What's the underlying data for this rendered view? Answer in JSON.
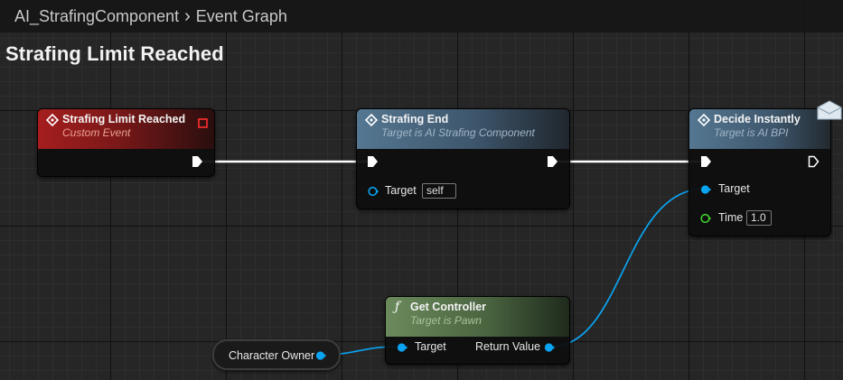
{
  "breadcrumb": {
    "blueprint": "AI_StrafingComponent",
    "graph": "Event Graph"
  },
  "graph_title": "Strafing Limit Reached",
  "nodes": {
    "event": {
      "title": "Strafing Limit Reached",
      "subtitle": "Custom Event",
      "header_color": "#a01c1c"
    },
    "strafing_end": {
      "title": "Strafing End",
      "subtitle": "Target is AI Strafing Component",
      "target_label": "Target",
      "target_value": "self",
      "header_color": "#4f6e8a"
    },
    "decide": {
      "title": "Decide Instantly",
      "subtitle": "Target is AI BPI",
      "target_label": "Target",
      "time_label": "Time",
      "time_value": "1.0",
      "header_color": "#4f6e8a"
    },
    "get_controller": {
      "title": "Get Controller",
      "subtitle": "Target is Pawn",
      "target_label": "Target",
      "return_label": "Return Value",
      "header_color": "#5c7a4f"
    },
    "character_owner": {
      "label": "Character Owner"
    }
  },
  "colors": {
    "object_pin": "#0aa4f0",
    "float_pin": "#3fd02e",
    "exec_wire": "#ffffff"
  },
  "icons": {
    "event": "event-diamond-icon",
    "function": "function-f-icon",
    "message": "envelope-icon"
  }
}
